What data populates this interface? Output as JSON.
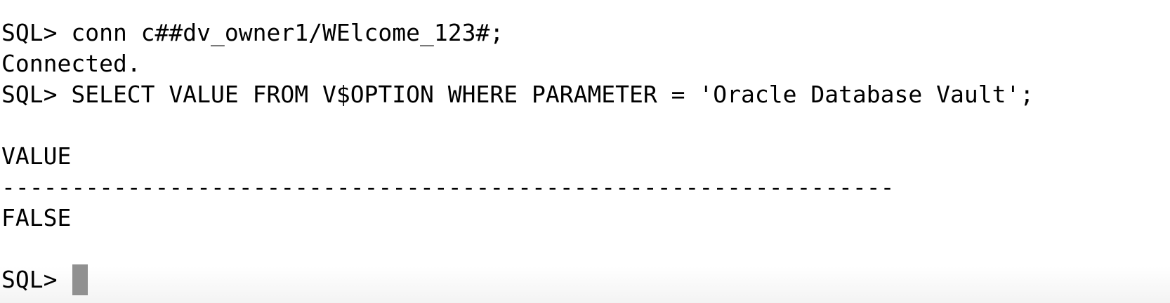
{
  "terminal": {
    "lines": {
      "connect_command": "SQL> conn c##dv_owner1/WElcome_123#;",
      "connected_message": "Connected.",
      "select_command": "SQL> SELECT VALUE FROM V$OPTION WHERE PARAMETER = 'Oracle Database Vault';",
      "column_header": "VALUE",
      "separator": "----------------------------------------------------------------",
      "result_value": "FALSE",
      "prompt": "SQL> "
    },
    "cursor_color": "#909090"
  }
}
